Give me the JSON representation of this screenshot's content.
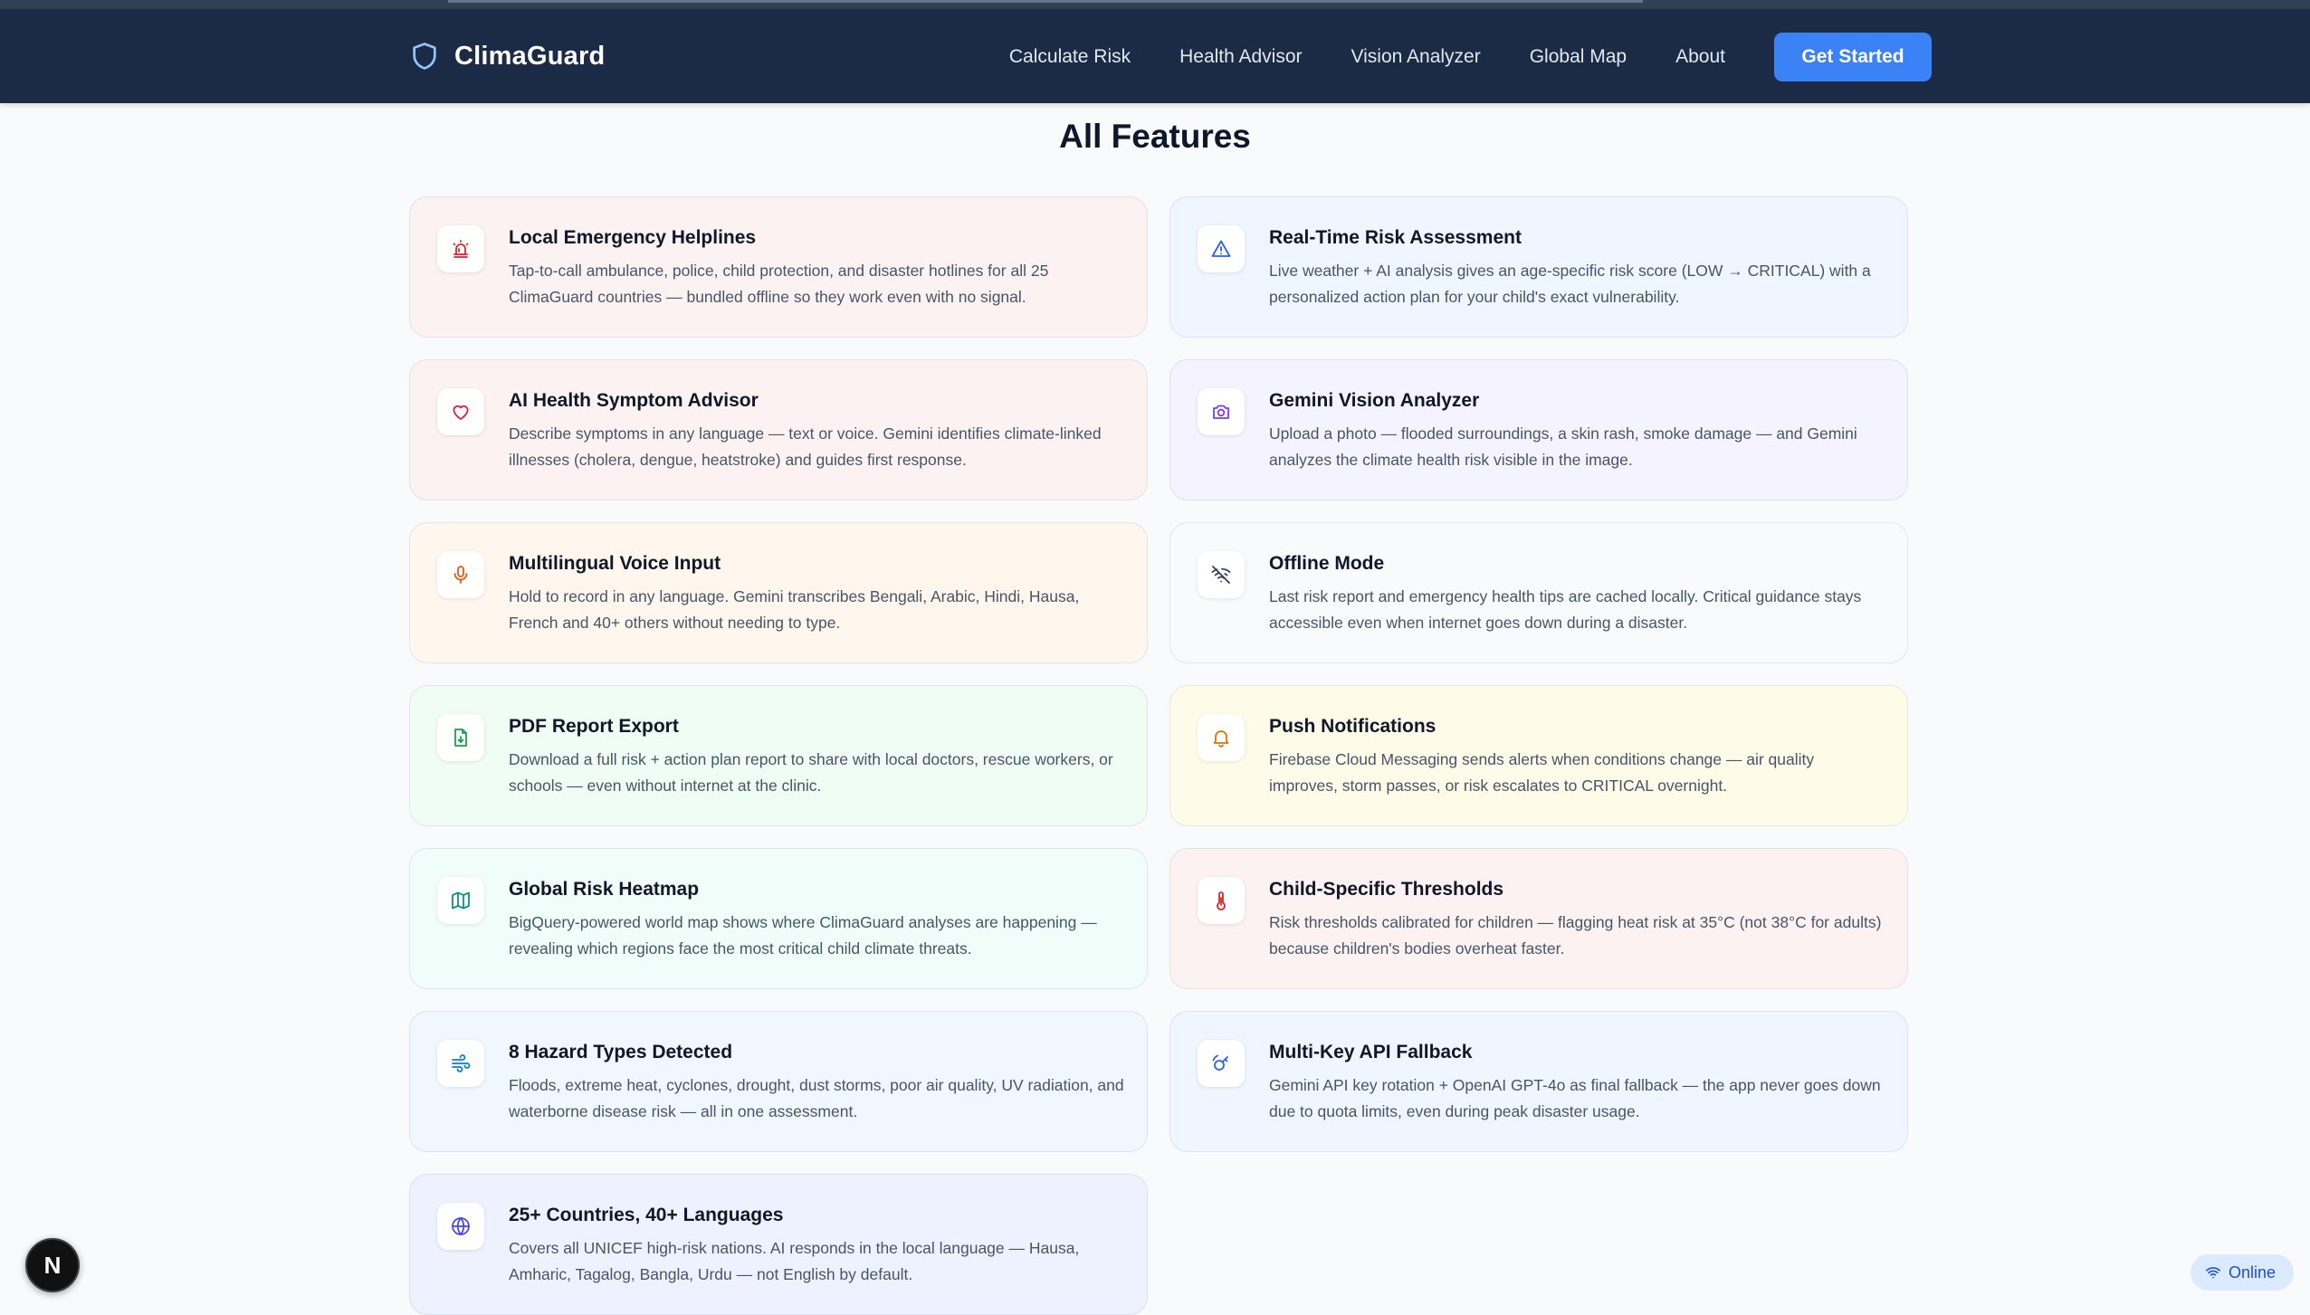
{
  "brand": {
    "name": "ClimaGuard",
    "logo_icon": "shield-icon"
  },
  "nav": {
    "links": [
      "Calculate Risk",
      "Health Advisor",
      "Vision Analyzer",
      "Global Map",
      "About"
    ],
    "cta_label": "Get Started"
  },
  "section_title": "All Features",
  "features": [
    {
      "title": "Local Emergency Helplines",
      "description": "Tap-to-call ambulance, police, child protection, and disaster hotlines for all 25 ClimaGuard countries — bundled offline so they work even with no signal.",
      "icon": "siren-icon",
      "bg": "#fdf2f2",
      "icon_color": "#dc2626"
    },
    {
      "title": "Real-Time Risk Assessment",
      "description": "Live weather + AI analysis gives an age-specific risk score (LOW → CRITICAL) with a personalized action plan for your child's exact vulnerability.",
      "icon": "warning-triangle-icon",
      "bg": "#eff6ff",
      "icon_color": "#2563eb"
    },
    {
      "title": "AI Health Symptom Advisor",
      "description": "Describe symptoms in any language — text or voice. Gemini identifies climate-linked illnesses (cholera, dengue, heatstroke) and guides first response.",
      "icon": "heart-icon",
      "bg": "#fdf2f2",
      "icon_color": "#e11d48"
    },
    {
      "title": "Gemini Vision Analyzer",
      "description": "Upload a photo — flooded surroundings, a skin rash, smoke damage — and Gemini analyzes the climate health risk visible in the image.",
      "icon": "camera-icon",
      "bg": "#f5f3ff",
      "icon_color": "#7c3aed"
    },
    {
      "title": "Multilingual Voice Input",
      "description": "Hold to record in any language. Gemini transcribes Bengali, Arabic, Hindi, Hausa, French and 40+ others without needing to type.",
      "icon": "microphone-icon",
      "bg": "#fff7ed",
      "icon_color": "#ea580c"
    },
    {
      "title": "Offline Mode",
      "description": "Last risk report and emergency health tips are cached locally. Critical guidance stays accessible even when internet goes down during a disaster.",
      "icon": "wifi-off-icon",
      "bg": "#f8fafc",
      "icon_color": "#334155"
    },
    {
      "title": "PDF Report Export",
      "description": "Download a full risk + action plan report to share with local doctors, rescue workers, or schools — even without internet at the clinic.",
      "icon": "file-download-icon",
      "bg": "#f0fdf4",
      "icon_color": "#16a34a"
    },
    {
      "title": "Push Notifications",
      "description": "Firebase Cloud Messaging sends alerts when conditions change — air quality improves, storm passes, or risk escalates to CRITICAL overnight.",
      "icon": "bell-icon",
      "bg": "#fefce8",
      "icon_color": "#d97706"
    },
    {
      "title": "Global Risk Heatmap",
      "description": "BigQuery-powered world map shows where ClimaGuard analyses are happening — revealing which regions face the most critical child climate threats.",
      "icon": "map-icon",
      "bg": "#f0fdf9",
      "icon_color": "#0d9488"
    },
    {
      "title": "Child-Specific Thresholds",
      "description": "Risk thresholds calibrated for children — flagging heat risk at 35°C (not 38°C for adults) because children's bodies overheat faster.",
      "icon": "thermometer-icon",
      "bg": "#fdf2f2",
      "icon_color": "#dc2626"
    },
    {
      "title": "8 Hazard Types Detected",
      "description": "Floods, extreme heat, cyclones, drought, dust storms, poor air quality, UV radiation, and waterborne disease risk — all in one assessment.",
      "icon": "wind-icon",
      "bg": "#f0f7ff",
      "icon_color": "#0284c7"
    },
    {
      "title": "Multi-Key API Fallback",
      "description": "Gemini API key rotation + OpenAI GPT-4o as final fallback — the app never goes down due to quota limits, even during peak disaster usage.",
      "icon": "key-rotate-icon",
      "bg": "#eff6ff",
      "icon_color": "#2563eb"
    },
    {
      "title": "25+ Countries, 40+ Languages",
      "description": "Covers all UNICEF high-risk nations. AI responds in the local language — Hausa, Amharic, Tagalog, Bangla, Urdu — not English by default.",
      "icon": "globe-icon",
      "bg": "#eef2ff",
      "icon_color": "#4f46e5"
    }
  ],
  "status": {
    "label": "Online",
    "icon": "wifi-icon"
  },
  "dev_badge": {
    "label": "N"
  }
}
